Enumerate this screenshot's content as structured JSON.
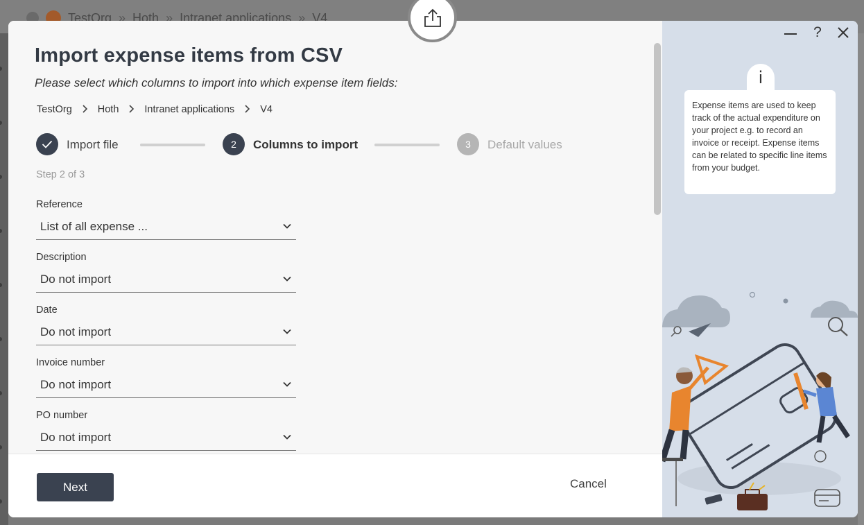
{
  "background": {
    "crumbs": [
      "TestOrg",
      "Hoth",
      "Intranet applications",
      "V4"
    ],
    "separator": "»"
  },
  "modal": {
    "title": "Import expense items from CSV",
    "subtitle": "Please select which columns to import into which expense item fields:",
    "breadcrumb": [
      "TestOrg",
      "Hoth",
      "Intranet applications",
      "V4"
    ],
    "steps": [
      {
        "number": "",
        "label": "Import file",
        "state": "done"
      },
      {
        "number": "2",
        "label": "Columns to import",
        "state": "active"
      },
      {
        "number": "3",
        "label": "Default values",
        "state": "pending"
      }
    ],
    "step_count": "Step 2 of 3",
    "fields": [
      {
        "label": "Reference",
        "value": "List of all expense ..."
      },
      {
        "label": "Description",
        "value": "Do not import"
      },
      {
        "label": "Date",
        "value": "Do not import"
      },
      {
        "label": "Invoice number",
        "value": "Do not import"
      },
      {
        "label": "PO number",
        "value": "Do not import"
      }
    ],
    "footer": {
      "next_label": "Next",
      "cancel_label": "Cancel"
    }
  },
  "help": {
    "info_glyph": "i",
    "text": "Expense items are used to keep track of the actual expenditure on your project e.g. to record an invoice or receipt. Expense items can be related to specific line items from your budget.",
    "controls": {
      "minimize": "—",
      "help": "?",
      "close": "✕"
    }
  },
  "colors": {
    "primary": "#3a4250",
    "pane_bg": "#d6dee9",
    "step_done": "#3a4250",
    "step_pending": "#b5b5b5",
    "illustration_orange": "#e8852e"
  },
  "icons": {
    "share": "share-icon",
    "check": "check-icon",
    "chevron_right": "chevron-right-icon",
    "chevron_down": "chevron-down-icon",
    "info": "info-icon"
  }
}
